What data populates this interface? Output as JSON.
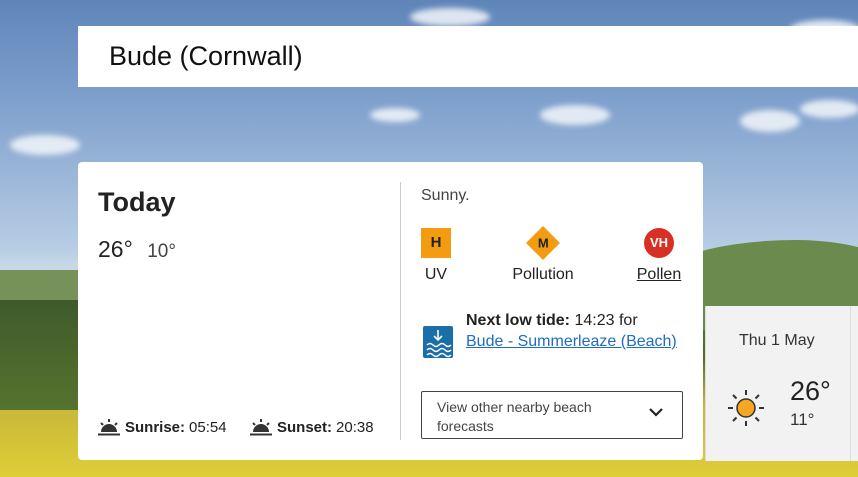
{
  "location": {
    "name": "Bude (Cornwall)"
  },
  "today": {
    "title": "Today",
    "high": "26°",
    "low": "10°",
    "sunrise_label": "Sunrise:",
    "sunrise_time": "05:54",
    "sunset_label": "Sunset:",
    "sunset_time": "20:38",
    "summary": "Sunny.",
    "uv": {
      "badge": "H",
      "label": "UV",
      "color": "#f39c12"
    },
    "pollution": {
      "badge": "M",
      "label": "Pollution",
      "color": "#f39c12"
    },
    "pollen": {
      "badge": "VH",
      "label": "Pollen",
      "color": "#d93025"
    },
    "tide": {
      "label": "Next low tide:",
      "time": "14:23",
      "suffix": "for",
      "location_link": "Bude - Summerleaze (Beach)"
    },
    "nearby_button": "View other nearby beach forecasts"
  },
  "forecast_day": {
    "label": "Thu 1 May",
    "icon": "sun-icon",
    "high": "26°",
    "low": "11°"
  }
}
